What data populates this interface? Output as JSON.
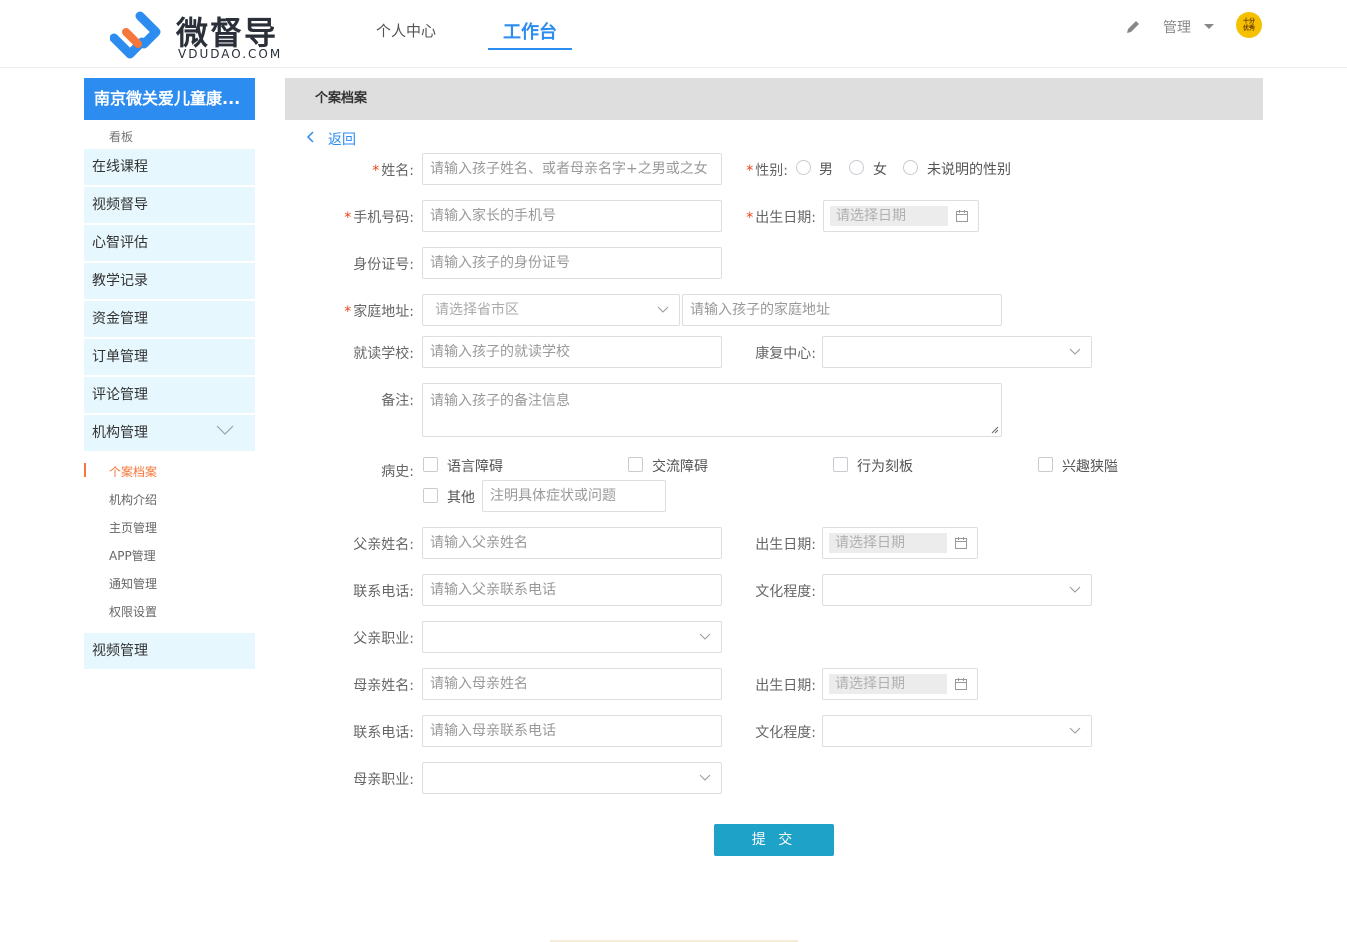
{
  "header": {
    "logo_text": "微督导",
    "logo_sub": "VDUDAO.COM",
    "nav": [
      "个人中心",
      "工作台"
    ],
    "manage_label": "管理",
    "avatar_text": [
      "十分",
      "优秀"
    ],
    "accent_color": "#2d8cf0"
  },
  "sidebar": {
    "org_title": "南京微关爱儿童康...",
    "dashboard": "看板",
    "items": [
      "在线课程",
      "视频督导",
      "心智评估",
      "教学记录",
      "资金管理",
      "订单管理",
      "评论管理",
      "机构管理"
    ],
    "sub_items": [
      "个案档案",
      "机构介绍",
      "主页管理",
      "APP管理",
      "通知管理",
      "权限设置"
    ],
    "last_item": "视频管理"
  },
  "panel": {
    "title": "个案档案",
    "back": "返回"
  },
  "form": {
    "name_label": "姓名:",
    "name_placeholder": "请输入孩子姓名、或者母亲名字+之男或之女",
    "gender_label": "性别:",
    "gender_options": [
      "男",
      "女",
      "未说明的性别"
    ],
    "phone_label": "手机号码:",
    "phone_placeholder": "请输入家长的手机号",
    "birth_label": "出生日期:",
    "date_placeholder": "请选择日期",
    "id_label": "身份证号:",
    "id_placeholder": "请输入孩子的身份证号",
    "address_label": "家庭地址:",
    "region_placeholder": "请选择省市区",
    "address_placeholder": "请输入孩子的家庭地址",
    "school_label": "就读学校:",
    "school_placeholder": "请输入孩子的就读学校",
    "center_label": "康复中心:",
    "remark_label": "备注:",
    "remark_placeholder": "请输入孩子的备注信息",
    "history_label": "病史:",
    "history_options": [
      "语言障碍",
      "交流障碍",
      "行为刻板",
      "兴趣狭隘",
      "其他"
    ],
    "other_placeholder": "注明具体症状或问题",
    "father_name_label": "父亲姓名:",
    "father_name_placeholder": "请输入父亲姓名",
    "father_birth_label": "出生日期:",
    "father_phone_label": "联系电话:",
    "father_phone_placeholder": "请输入父亲联系电话",
    "father_edu_label": "文化程度:",
    "father_job_label": "父亲职业:",
    "mother_name_label": "母亲姓名:",
    "mother_name_placeholder": "请输入母亲姓名",
    "mother_birth_label": "出生日期:",
    "mother_phone_label": "联系电话:",
    "mother_phone_placeholder": "请输入母亲联系电话",
    "mother_edu_label": "文化程度:",
    "mother_job_label": "母亲职业:",
    "submit": "提 交"
  }
}
